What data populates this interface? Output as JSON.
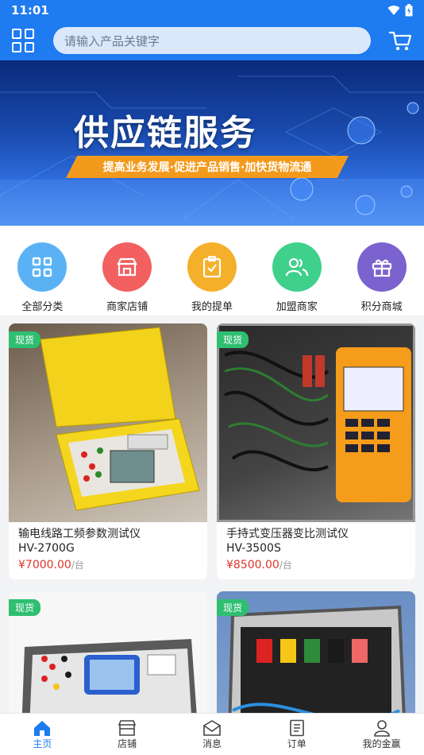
{
  "status": {
    "time": "11:01"
  },
  "header": {
    "search_placeholder": "请输入产品关键字"
  },
  "banner": {
    "title": "供应链服务",
    "tagline": "提高业务发展·促进产品销售·加快货物流通"
  },
  "quick": [
    {
      "label": "全部分类",
      "color": "#5ab2f5",
      "icon": "grid-icon"
    },
    {
      "label": "商家店铺",
      "color": "#f26060",
      "icon": "store-icon"
    },
    {
      "label": "我的提单",
      "color": "#f5b02b",
      "icon": "clipboard-check-icon"
    },
    {
      "label": "加盟商家",
      "color": "#3fd08c",
      "icon": "users-icon"
    },
    {
      "label": "积分商城",
      "color": "#7a63cf",
      "icon": "gift-icon"
    }
  ],
  "products": [
    {
      "badge": "现货",
      "title": "输电线路工频参数测试仪",
      "model": "HV-2700G",
      "price": "¥7000.00",
      "unit": "/台"
    },
    {
      "badge": "现货",
      "title": "手持式变压器变比测试仪",
      "model": "HV-3500S",
      "price": "¥8500.00",
      "unit": "/台"
    },
    {
      "badge": "现货"
    },
    {
      "badge": "现货"
    }
  ],
  "tabs": [
    {
      "label": "主页",
      "icon": "home-icon",
      "active": true
    },
    {
      "label": "店铺",
      "icon": "shop-icon"
    },
    {
      "label": "消息",
      "icon": "message-icon"
    },
    {
      "label": "订单",
      "icon": "order-icon"
    },
    {
      "label": "我的金赢",
      "icon": "profile-icon"
    }
  ],
  "colors": {
    "primary": "#1e7bf0",
    "price": "#e0342a",
    "badge": "#2fbf71"
  }
}
